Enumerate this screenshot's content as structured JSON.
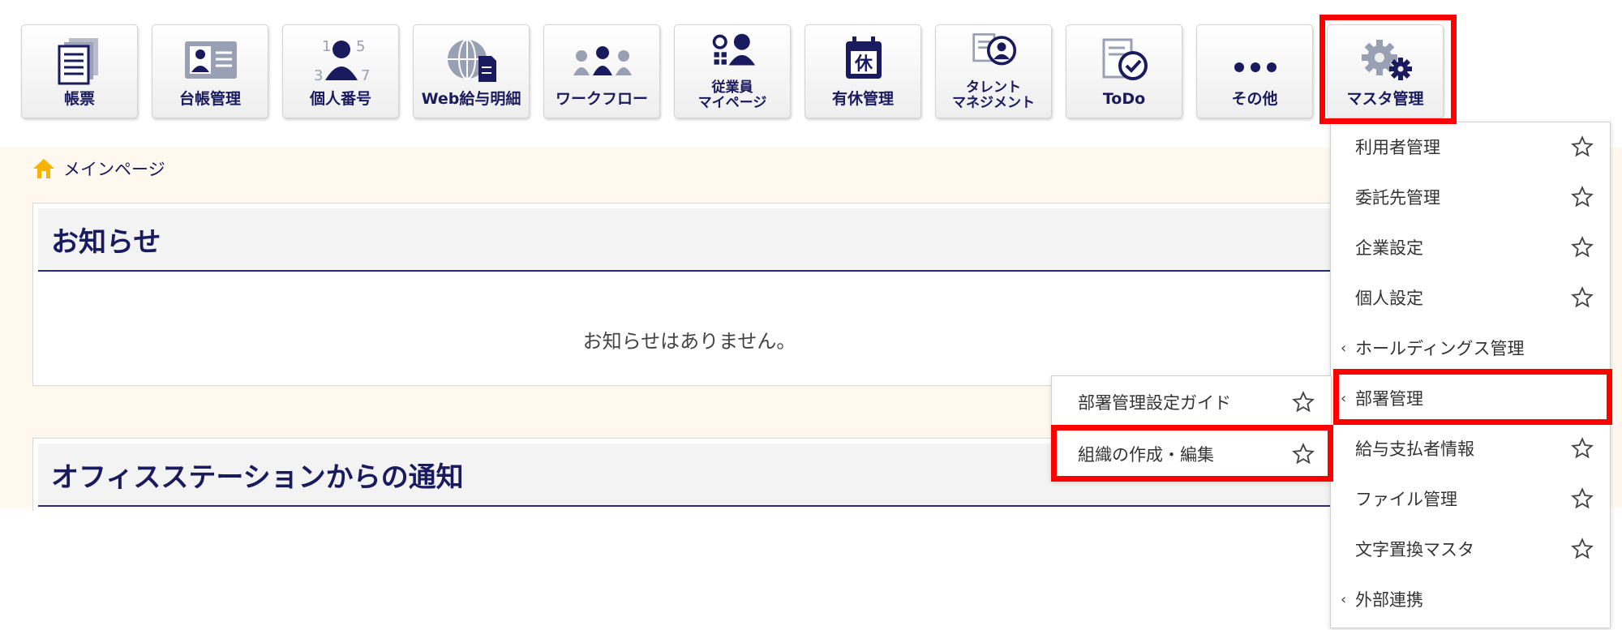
{
  "nav": {
    "tiles": [
      {
        "label": "帳票",
        "icon": "report-icon"
      },
      {
        "label": "台帳管理",
        "icon": "ledger-icon"
      },
      {
        "label": "個人番号",
        "icon": "personal-number-icon"
      },
      {
        "label": "Web給与明細",
        "icon": "web-payslip-icon"
      },
      {
        "label": "ワークフロー",
        "icon": "workflow-icon"
      },
      {
        "label": "従業員\nマイページ",
        "icon": "employee-mypage-icon"
      },
      {
        "label": "有休管理",
        "icon": "paid-leave-icon",
        "badge": "休"
      },
      {
        "label": "タレント\nマネジメント",
        "icon": "talent-management-icon"
      },
      {
        "label": "ToDo",
        "icon": "todo-icon"
      },
      {
        "label": "その他",
        "icon": "more-icon"
      },
      {
        "label": "マスタ管理",
        "icon": "gear-icon"
      }
    ]
  },
  "breadcrumb": {
    "home_label": "メインページ"
  },
  "notices": {
    "title": "お知らせ",
    "empty_message": "お知らせはありません。"
  },
  "office_notices": {
    "title": "オフィスステーションからの通知"
  },
  "master_menu": {
    "items": [
      {
        "label": "利用者管理",
        "has_submenu": false
      },
      {
        "label": "委託先管理",
        "has_submenu": false
      },
      {
        "label": "企業設定",
        "has_submenu": false
      },
      {
        "label": "個人設定",
        "has_submenu": false
      },
      {
        "label": "ホールディングス管理",
        "has_submenu": true
      },
      {
        "label": "部署管理",
        "has_submenu": true
      },
      {
        "label": "給与支払者情報",
        "has_submenu": false
      },
      {
        "label": "ファイル管理",
        "has_submenu": false
      },
      {
        "label": "文字置換マスタ",
        "has_submenu": false
      },
      {
        "label": "外部連携",
        "has_submenu": true
      }
    ]
  },
  "department_submenu": {
    "items": [
      {
        "label": "部署管理設定ガイド"
      },
      {
        "label": "組織の作成・編集"
      }
    ]
  },
  "colors": {
    "accent_navy": "#1a1a5e",
    "highlight_red": "#ff0000",
    "icon_gray": "#8a8fa3",
    "home_icon": "#f5b400"
  }
}
